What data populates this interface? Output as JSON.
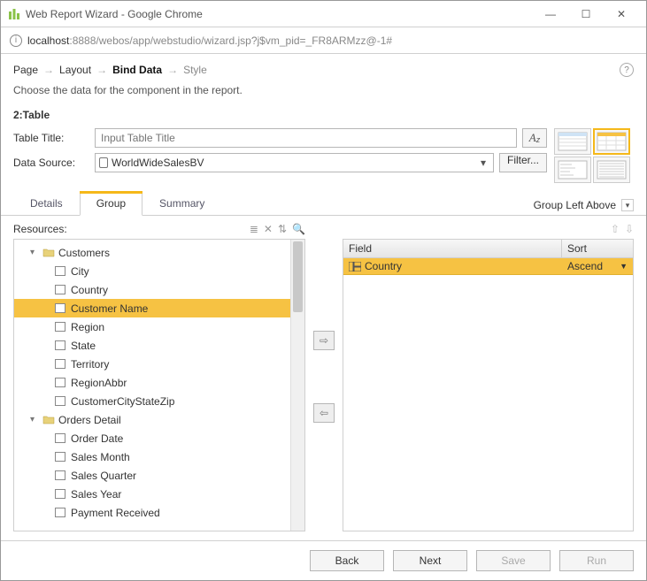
{
  "window": {
    "title": "Web Report Wizard - Google Chrome",
    "url_host": "localhost",
    "url_path": ":8888/webos/app/webstudio/wizard.jsp?j$vm_pid=_FR8ARMzz@-1#"
  },
  "breadcrumbs": {
    "steps": [
      "Page",
      "Layout",
      "Bind Data",
      "Style"
    ],
    "active_index": 2
  },
  "instruction": "Choose the data for the component in the report.",
  "section": "2:Table",
  "form": {
    "title_label": "Table Title:",
    "title_placeholder": "Input Table Title",
    "ds_label": "Data Source:",
    "ds_value": "WorldWideSalesBV",
    "filter_label": "Filter..."
  },
  "tabs": {
    "items": [
      "Details",
      "Group",
      "Summary"
    ],
    "active_index": 1,
    "group_option": "Group Left Above"
  },
  "resources": {
    "label": "Resources:",
    "tree": [
      {
        "label": "Customers",
        "type": "folder",
        "level": 1,
        "expanded": true
      },
      {
        "label": "City",
        "type": "field",
        "level": 2
      },
      {
        "label": "Country",
        "type": "field",
        "level": 2
      },
      {
        "label": "Customer Name",
        "type": "field",
        "level": 2,
        "selected": true
      },
      {
        "label": "Region",
        "type": "field",
        "level": 2
      },
      {
        "label": "State",
        "type": "field",
        "level": 2
      },
      {
        "label": "Territory",
        "type": "field",
        "level": 2
      },
      {
        "label": "RegionAbbr",
        "type": "field",
        "level": 2
      },
      {
        "label": "CustomerCityStateZip",
        "type": "field",
        "level": 2
      },
      {
        "label": "Orders Detail",
        "type": "folder",
        "level": 1,
        "expanded": true
      },
      {
        "label": "Order Date",
        "type": "field",
        "level": 2
      },
      {
        "label": "Sales Month",
        "type": "field",
        "level": 2
      },
      {
        "label": "Sales Quarter",
        "type": "field",
        "level": 2
      },
      {
        "label": "Sales Year",
        "type": "field",
        "level": 2
      },
      {
        "label": "Payment Received",
        "type": "field",
        "level": 2
      }
    ]
  },
  "field_table": {
    "columns": {
      "field": "Field",
      "sort": "Sort"
    },
    "rows": [
      {
        "field": "Country",
        "sort": "Ascend"
      }
    ]
  },
  "footer": {
    "back": "Back",
    "next": "Next",
    "save": "Save",
    "run": "Run"
  }
}
